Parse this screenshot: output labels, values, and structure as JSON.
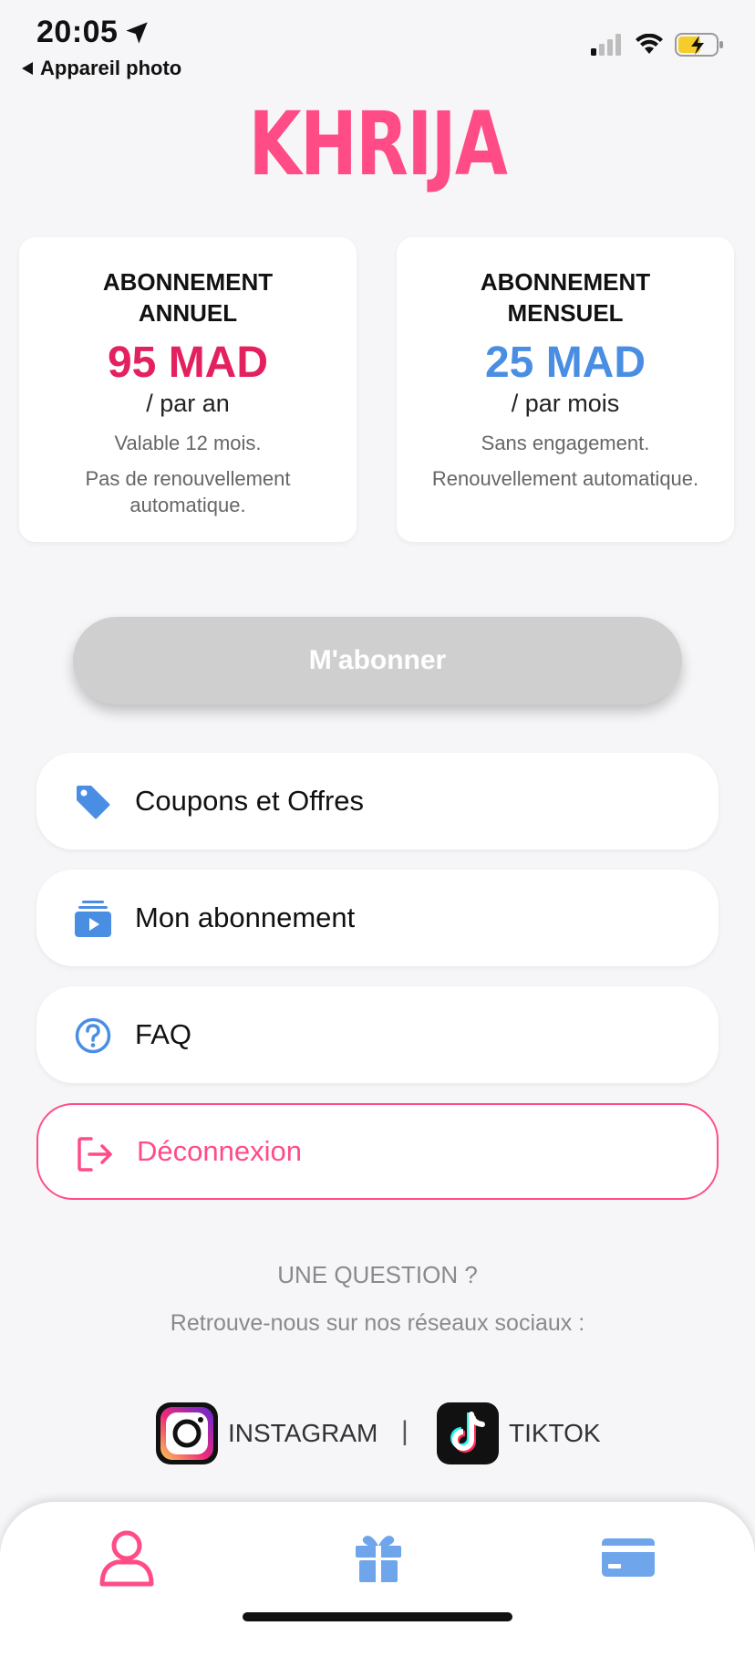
{
  "status_bar": {
    "time": "20:05",
    "back_app": "Appareil photo",
    "icons": [
      "location-arrow-icon",
      "cellular-signal-icon",
      "wifi-icon",
      "battery-charging-icon"
    ]
  },
  "logo": {
    "text": "KHRIJA",
    "color": "#FF4C86"
  },
  "plans": {
    "annual": {
      "title": "ABONNEMENT ANNUEL",
      "price": "95 MAD",
      "period": "/ par an",
      "note1": "Valable 12 mois.",
      "note2": "Pas de renouvellement automatique.",
      "price_color": "#E3215F"
    },
    "monthly": {
      "title": "ABONNEMENT MENSUEL",
      "price": "25 MAD",
      "period": "/ par mois",
      "note1": "Sans engagement.",
      "note2": "Renouvellement automatique.",
      "price_color": "#4A8EE4"
    }
  },
  "subscribe_button": {
    "label": "M'abonner"
  },
  "menu": {
    "coupons": {
      "label": "Coupons et Offres",
      "icon": "tag-icon"
    },
    "subscription": {
      "label": "Mon abonnement",
      "icon": "subscription-icon"
    },
    "faq": {
      "label": "FAQ",
      "icon": "question-circle-icon"
    },
    "logout": {
      "label": "Déconnexion",
      "icon": "logout-icon"
    }
  },
  "help": {
    "title": "UNE QUESTION ?",
    "subtitle": "Retrouve-nous sur nos réseaux sociaux :",
    "instagram": "INSTAGRAM",
    "separator": "|",
    "tiktok": "TIKTOK"
  },
  "tabbar": {
    "tabs": [
      {
        "icon": "profile-icon",
        "active": true
      },
      {
        "icon": "gift-icon",
        "active": false
      },
      {
        "icon": "credit-card-icon",
        "active": false
      }
    ]
  },
  "colors": {
    "accent": "#FF4C86",
    "blue": "#4A8EE4",
    "background": "#F6F6F8"
  }
}
